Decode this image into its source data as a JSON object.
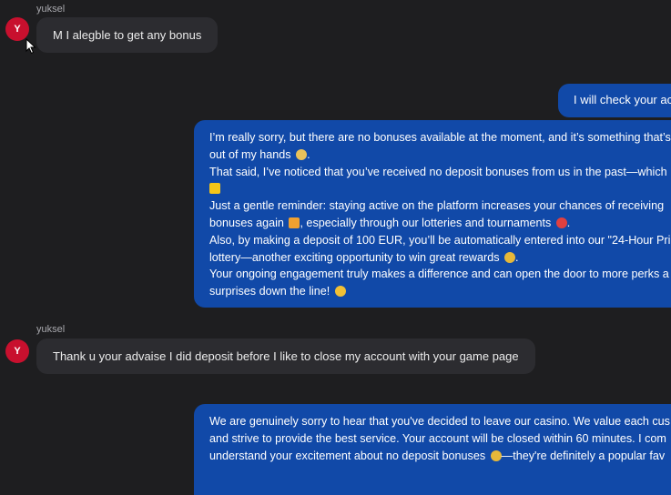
{
  "messages": [
    {
      "sender": "yuksel",
      "avatar_initial": "Y",
      "text": "M I alegble to get any bonus"
    },
    {
      "agent_text": "I will check your ac"
    },
    {
      "agent_lines": [
        "I’m really sorry, but there are no bonuses available at the moment, and it’s something that’s",
        "out of my hands",
        "That said, I’ve noticed that you’ve received no deposit bonuses from us in the past—which",
        "",
        "Just a gentle reminder: staying active on the platform increases your chances of receiving",
        "bonuses again",
        ", especially through our lotteries and tournaments",
        "Also, by making a deposit of 100 EUR, you’ll be automatically entered into our \"24-Hour Pri",
        "lottery—another exciting opportunity to win great rewards",
        "Your ongoing engagement truly makes a difference and can open the door to more perks a",
        "surprises down the line!"
      ]
    },
    {
      "sender": "yuksel",
      "avatar_initial": "Y",
      "text": "Thank u your advaise I did deposit before I like to close my account with your game page"
    },
    {
      "agent_lines": [
        "We are genuinely sorry to hear that you've decided to leave our casino. We value each cus",
        "and strive to provide the best service. Your account will be closed within 60 minutes. I com",
        "understand your excitement about no deposit bonuses",
        "—they're definitely a popular fav"
      ]
    }
  ],
  "emoji": {
    "hands": "pray-emoji",
    "star": "star-emoji",
    "gift": "gift-emoji",
    "target": "target-emoji",
    "party": "party-popper-emoji",
    "smile": "smile-emoji"
  },
  "colors": {
    "background": "#1e1e20",
    "incoming_bubble": "#2c2c30",
    "outgoing_bubble": "#1149a8",
    "avatar": "#c8102e"
  }
}
